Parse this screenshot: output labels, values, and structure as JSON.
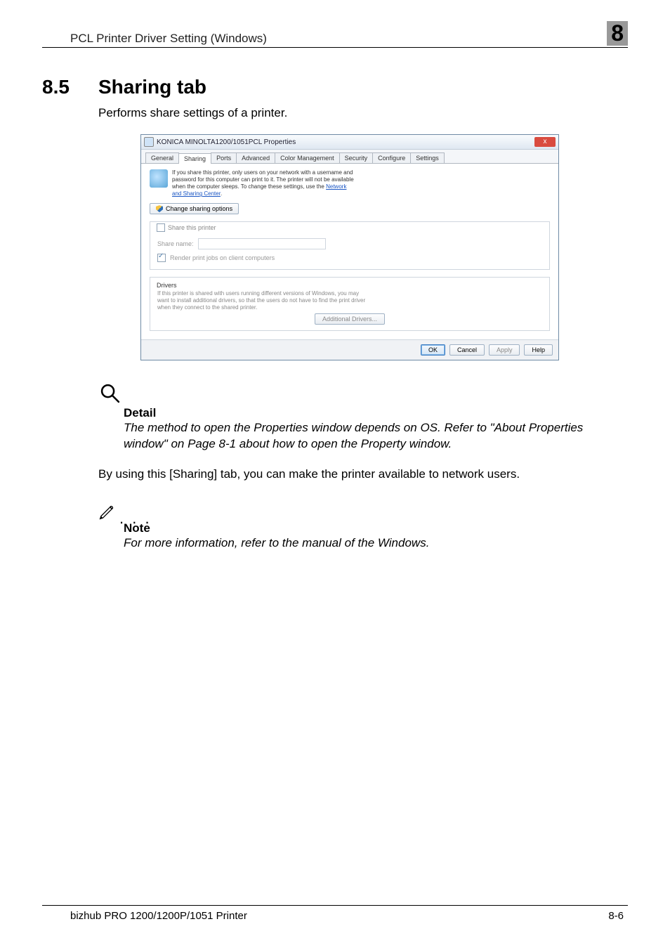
{
  "header": {
    "left": "PCL Printer Driver Setting (Windows)",
    "right": "8"
  },
  "section": {
    "number": "8.5",
    "title": "Sharing tab",
    "intro": "Performs share settings of a printer."
  },
  "dialog": {
    "title": "KONICA MINOLTA1200/1051PCL Properties",
    "close": "x",
    "tabs": {
      "general": "General",
      "sharing": "Sharing",
      "ports": "Ports",
      "advanced": "Advanced",
      "color": "Color Management",
      "security": "Security",
      "configure": "Configure",
      "settings": "Settings"
    },
    "info_text_1": "If you share this printer, only users on your network with a username and password for this computer can print to it. The printer will not be available when the computer sleeps. To change these settings, use the ",
    "info_link": "Network and Sharing Center",
    "info_text_2": ".",
    "change_sharing": "Change sharing options",
    "share_this_printer": "Share this printer",
    "share_name_label": "Share name:",
    "render_jobs": "Render print jobs on client computers",
    "drivers_label": "Drivers",
    "drivers_text": "If this printer is shared with users running different versions of Windows, you may want to install additional drivers, so that the users do not have to find the print driver when they connect to the shared printer.",
    "additional_drivers": "Additional Drivers...",
    "ok": "OK",
    "cancel": "Cancel",
    "apply": "Apply",
    "help": "Help"
  },
  "detail": {
    "label": "Detail",
    "text": "The method to open the Properties window depends on OS. Refer to \"About Properties window\" on Page 8-1 about how to open the Property window."
  },
  "usage_text": "By using this [Sharing] tab, you can make the printer available to network users.",
  "note": {
    "label": "Note",
    "text": "For more information, refer to the manual of the Windows."
  },
  "footer": {
    "left": "bizhub PRO 1200/1200P/1051 Printer",
    "right": "8-6"
  }
}
